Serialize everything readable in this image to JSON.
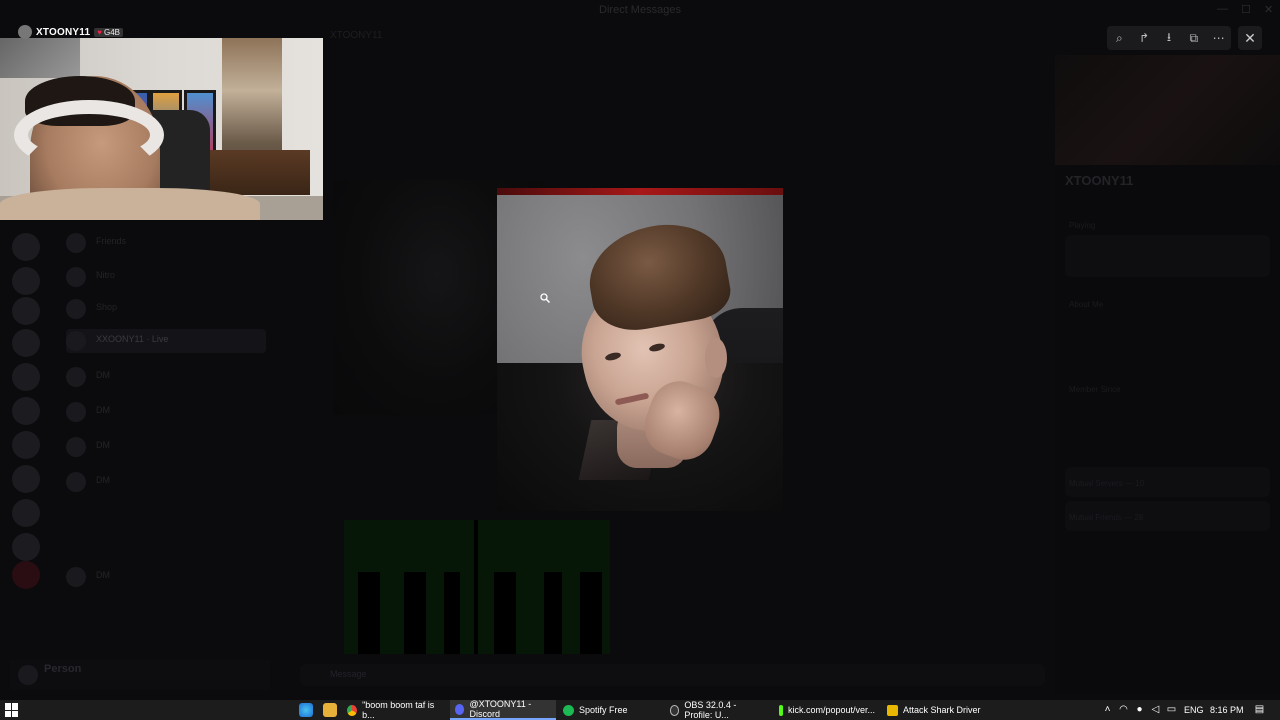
{
  "window": {
    "title": "Direct Messages"
  },
  "background": {
    "channel_header": "XTOONY11",
    "dm_list": [
      {
        "name": "Friends"
      },
      {
        "name": "Nitro"
      },
      {
        "name": "Shop"
      },
      {
        "name": "XXOONY11 · Live"
      },
      {
        "name": "DM"
      },
      {
        "name": "DM"
      },
      {
        "name": "DM"
      },
      {
        "name": "DM"
      },
      {
        "name": "DM"
      }
    ],
    "profile_name": "XTOONY11",
    "profile_sections": [
      "Playing",
      "About Me",
      "Member Since",
      "Mutual Servers — 10",
      "Mutual Friends — 28"
    ],
    "user_bar_name": "Person",
    "chat_input_placeholder": "Message"
  },
  "viewer": {
    "tools": [
      {
        "icon": "zoom-icon",
        "glyph": "⌕"
      },
      {
        "icon": "forward-icon",
        "glyph": "↱"
      },
      {
        "icon": "download-icon",
        "glyph": "⭳"
      },
      {
        "icon": "open-external-icon",
        "glyph": "⧉"
      },
      {
        "icon": "more-icon",
        "glyph": "⋯"
      }
    ],
    "close_glyph": "✕"
  },
  "stream_overlay": {
    "streamer_name": "XTOONY11",
    "badge_text": "G4B",
    "badge_heart": "♥"
  },
  "taskbar": {
    "apps": [
      {
        "label": "\"boom boom taf is b...",
        "icon_color": "#4285f4",
        "active": false
      },
      {
        "label": "@XTOONY11 - Discord",
        "icon_color": "#5865f2",
        "active": true
      },
      {
        "label": "Spotify Free",
        "icon_color": "#1db954",
        "active": false
      },
      {
        "label": "OBS 32.0.4 - Profile: U...",
        "icon_color": "#bbbbbb",
        "active": false
      },
      {
        "label": "kick.com/popout/ver...",
        "icon_color": "#53fc18",
        "active": false
      },
      {
        "label": "Attack Shark Driver",
        "icon_color": "#e8b800",
        "active": false
      }
    ],
    "language": "ENG",
    "time": "8:16 PM"
  },
  "colors": {
    "accent": "#78a6ff",
    "taskbar_bg": "#1c1c1c"
  }
}
